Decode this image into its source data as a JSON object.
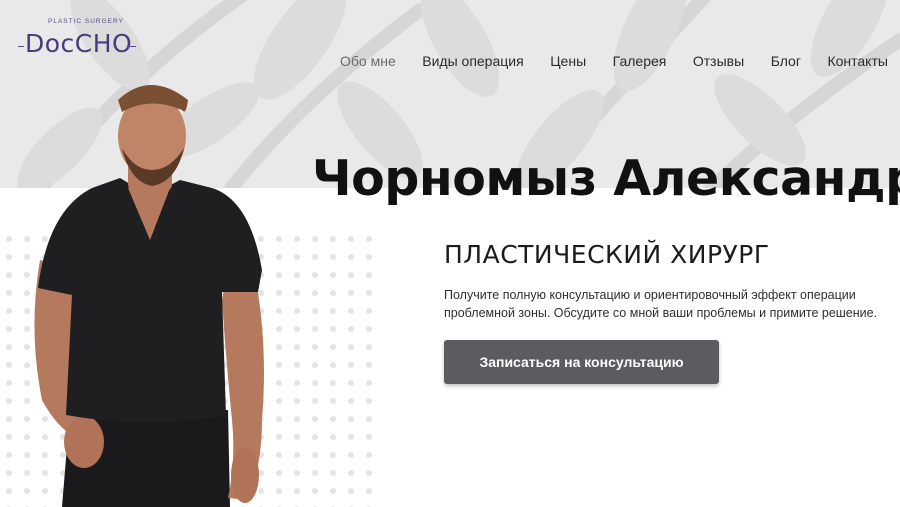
{
  "brand": {
    "tagline": "PLASTIC SURGERY",
    "name": "DocCHO"
  },
  "nav": {
    "items": [
      {
        "label": "Обо мне",
        "active": true
      },
      {
        "label": "Виды операция",
        "active": false
      },
      {
        "label": "Цены",
        "active": false
      },
      {
        "label": "Галерея",
        "active": false
      },
      {
        "label": "Отзывы",
        "active": false
      },
      {
        "label": "Блог",
        "active": false
      },
      {
        "label": "Контакты",
        "active": false
      }
    ]
  },
  "hero": {
    "name": "Чорномыз Александр",
    "title": "ПЛАСТИЧЕСКИЙ ХИРУРГ",
    "description": "Получите полную консультацию и ориентировочный эффект операции проблемной зоны. Обсудите со мной ваши проблемы и примите решение.",
    "cta_label": "Записаться на консультацию"
  },
  "colors": {
    "brand": "#4b3a7c",
    "hero_band": "#e9e9e9",
    "button": "#5c5b60",
    "heading": "#111111"
  },
  "icons": {
    "background_pattern": "leaf-pattern",
    "dots_pattern": "dot-grid"
  }
}
